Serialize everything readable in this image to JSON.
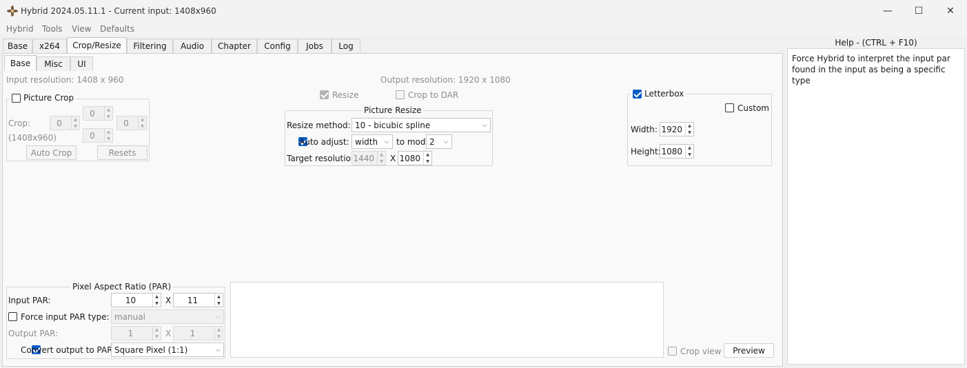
{
  "window": {
    "title": "Hybrid 2024.05.11.1 - Current input: 1408x960",
    "minimize": "—",
    "maximize": "☐",
    "close": "✕"
  },
  "menu": [
    "Hybrid",
    "Tools",
    "View",
    "Defaults"
  ],
  "main_tabs": [
    "Base",
    "x264",
    "Crop/Resize",
    "Filtering",
    "Audio",
    "Chapter",
    "Config",
    "Jobs",
    "Log"
  ],
  "sub_tabs": [
    "Base",
    "Misc",
    "UI"
  ],
  "input_resolution": "Input resolution: 1408 x 960",
  "output_resolution": "Output resolution: 1920 x 1080",
  "resize_checkbox": "Resize",
  "crop_to_dar": "Crop to DAR",
  "picture_crop": {
    "title": "Picture Crop",
    "crop_label": "Crop:",
    "size_label": "(1408x960)",
    "top": "0",
    "left": "0",
    "right": "0",
    "bottom": "0",
    "auto_crop": "Auto Crop",
    "resets": "Resets"
  },
  "picture_resize": {
    "title": "Picture Resize",
    "method_label": "Resize method:",
    "method_value": "10 - bicubic spline",
    "auto_adjust_label": "Auto adjust:",
    "auto_adjust_value": "width",
    "to_mod_label": "to mod",
    "mod_value": "2",
    "target_label": "Target resolution:",
    "target_w": "1440",
    "x_sep": "X",
    "target_h": "1080"
  },
  "letterbox": {
    "title": "Letterbox",
    "custom": "Custom",
    "width_label": "Width:",
    "width_value": "1920",
    "height_label": "Height:",
    "height_value": "1080"
  },
  "par": {
    "title": "Pixel Aspect Ratio (PAR)",
    "input_label": "Input PAR:",
    "input_a": "10",
    "input_b": "11",
    "x_sep": "X",
    "force_label": "Force input PAR type:",
    "force_value": "manual",
    "output_label": "Output PAR:",
    "output_a": "1",
    "output_b": "1",
    "convert_label": "Convert output to PAR:",
    "convert_value": "Square Pixel (1:1)"
  },
  "crop_view": "Crop view",
  "preview": "Preview",
  "help": {
    "title": "Help - (CTRL + F10)",
    "text": "Force Hybrid to interpret the input par found in the input as being a specific type"
  },
  "colors": {
    "accent": "#0b5cc9",
    "background": "#f0f0f0"
  },
  "icons": {
    "spin_up": "▲",
    "spin_down": "▼",
    "dropdown": "⌵"
  }
}
